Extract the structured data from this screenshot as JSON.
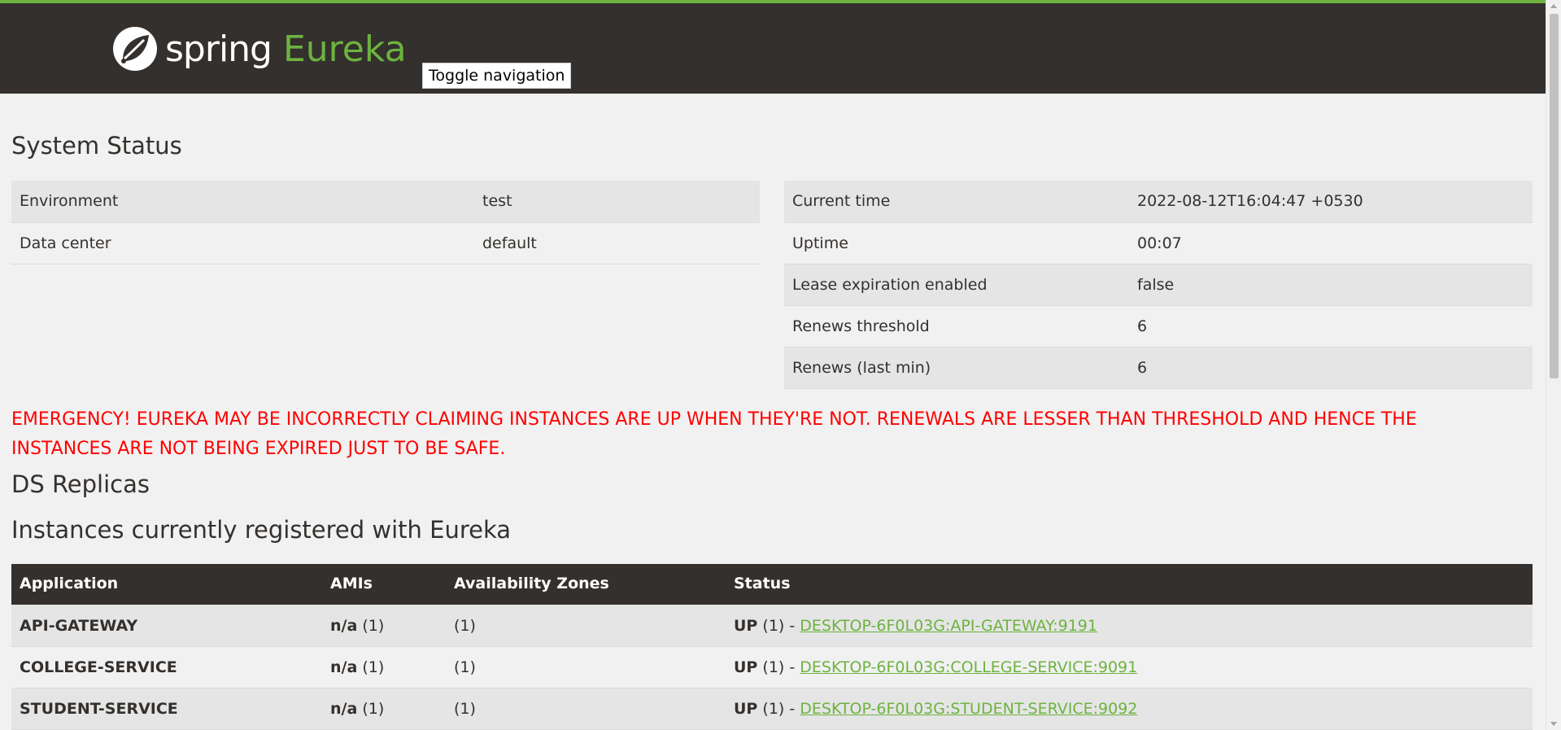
{
  "header": {
    "brand_spring": "spring",
    "brand_eureka": "Eureka",
    "toggle_label": "Toggle navigation",
    "accent_color": "#6db33f",
    "background_color": "#34302d"
  },
  "system_status": {
    "title": "System Status",
    "left": [
      {
        "label": "Environment",
        "value": "test"
      },
      {
        "label": "Data center",
        "value": "default"
      }
    ],
    "right": [
      {
        "label": "Current time",
        "value": "2022-08-12T16:04:47 +0530"
      },
      {
        "label": "Uptime",
        "value": "00:07"
      },
      {
        "label": "Lease expiration enabled",
        "value": "false"
      },
      {
        "label": "Renews threshold",
        "value": "6"
      },
      {
        "label": "Renews (last min)",
        "value": "6"
      }
    ]
  },
  "emergency": {
    "line1": "EMERGENCY! EUREKA MAY BE INCORRECTLY CLAIMING INSTANCES ARE UP WHEN THEY'RE NOT. RENEWALS ARE LESSER THAN THRESHOLD AND HENCE THE",
    "line2": "INSTANCES ARE NOT BEING EXPIRED JUST TO BE SAFE.",
    "color": "#ff0000"
  },
  "ds_replicas": {
    "title": "DS Replicas"
  },
  "instances": {
    "title": "Instances currently registered with Eureka",
    "columns": [
      "Application",
      "AMIs",
      "Availability Zones",
      "Status"
    ],
    "rows": [
      {
        "application": "API-GATEWAY",
        "ami": "n/a",
        "ami_count": "(1)",
        "zones": "(1)",
        "status": "UP",
        "status_count": "(1) -",
        "link": "DESKTOP-6F0L03G:API-GATEWAY:9191"
      },
      {
        "application": "COLLEGE-SERVICE",
        "ami": "n/a",
        "ami_count": "(1)",
        "zones": "(1)",
        "status": "UP",
        "status_count": "(1) -",
        "link": "DESKTOP-6F0L03G:COLLEGE-SERVICE:9091"
      },
      {
        "application": "STUDENT-SERVICE",
        "ami": "n/a",
        "ami_count": "(1)",
        "zones": "(1)",
        "status": "UP",
        "status_count": "(1) -",
        "link": "DESKTOP-6F0L03G:STUDENT-SERVICE:9092"
      }
    ]
  }
}
